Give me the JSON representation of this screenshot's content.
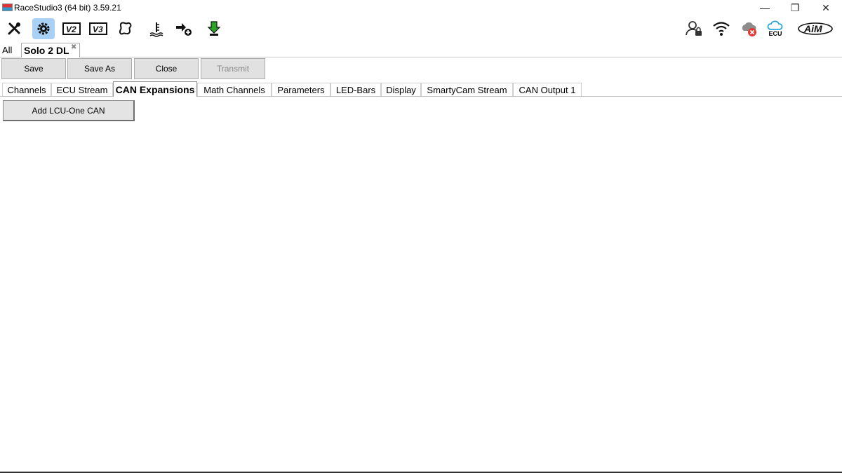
{
  "window": {
    "title": "RaceStudio3 (64 bit) 3.59.21",
    "minimize": "—",
    "restore": "❐",
    "close": "✕"
  },
  "toolbar": {
    "icons": [
      "wrench-icon",
      "gear-icon",
      "v2-icon",
      "v3-icon",
      "track-map-icon",
      "data-sensor-icon",
      "add-device-icon",
      "transfer-icon"
    ],
    "v2_label": "V2",
    "v3_label": "V3",
    "ecu_label": "ECU",
    "brand_logo": "AiM"
  },
  "doc_tabs": {
    "all": "All",
    "active": "Solo 2 DL",
    "close_glyph": "✖"
  },
  "actions": {
    "save": "Save",
    "save_as": "Save As",
    "close": "Close",
    "transmit": "Transmit"
  },
  "subtabs": [
    "Channels",
    "ECU Stream",
    "CAN Expansions",
    "Math Channels",
    "Parameters",
    "LED-Bars",
    "Display",
    "SmartyCam Stream",
    "CAN Output 1"
  ],
  "active_subtab": "CAN Expansions",
  "main": {
    "add_button": "Add LCU-One CAN"
  },
  "colors": {
    "active_tool_bg": "#a9d1f5",
    "button_bg": "#e1e1e1",
    "cloud_blue": "#29a8e0",
    "error_red": "#e53935",
    "transfer_green": "#2aa52a"
  }
}
